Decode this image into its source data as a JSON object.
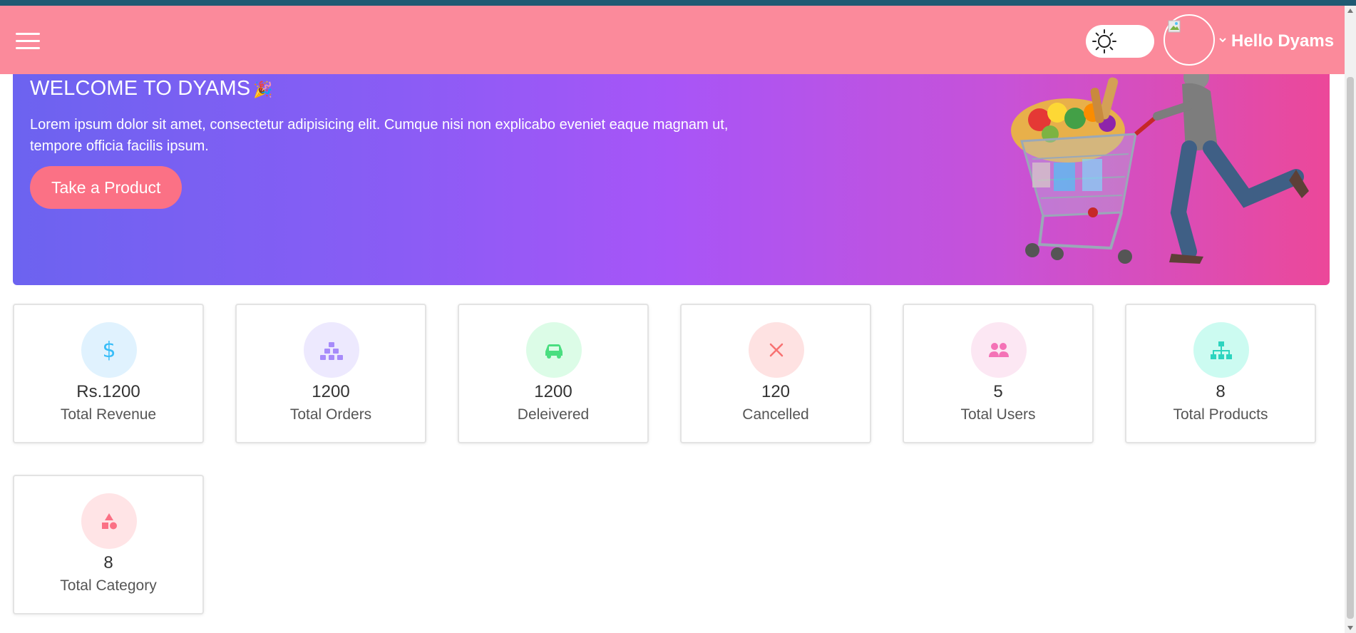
{
  "header": {
    "greeting": "Hello Dyams",
    "menu_icon": "hamburger-icon",
    "theme_icon": "sun-icon",
    "chevron_icon": "chevron-down-icon",
    "bg_color": "#fb8a9b"
  },
  "hero": {
    "title": "WELCOME TO DYAMS",
    "title_icon": "party-popper-icon",
    "text": "Lorem ipsum dolor sit amet, consectetur adipisicing elit. Cumque nisi non explicabo eveniet eaque magnam ut, tempore officia facilis ipsum.",
    "button_label": "Take a Product",
    "button_color": "#fb7185"
  },
  "stats": [
    {
      "value": "Rs.1200",
      "label": "Total Revenue",
      "icon": "dollar-icon",
      "color": "#38bdf8",
      "bg": "#e0f2fe"
    },
    {
      "value": "1200",
      "label": "Total Orders",
      "icon": "boxes-icon",
      "color": "#a78bfa",
      "bg": "#ede9fe"
    },
    {
      "value": "1200",
      "label": "Deleivered",
      "icon": "car-icon",
      "color": "#4ade80",
      "bg": "#dcfce7"
    },
    {
      "value": "120",
      "label": "Cancelled",
      "icon": "close-icon",
      "color": "#f87171",
      "bg": "#fee2e2"
    },
    {
      "value": "5",
      "label": "Total Users",
      "icon": "users-icon",
      "color": "#f472b6",
      "bg": "#fce7f3"
    },
    {
      "value": "8",
      "label": "Total Products",
      "icon": "sitemap-icon",
      "color": "#2dd4bf",
      "bg": "#ccfbf1"
    },
    {
      "value": "8",
      "label": "Total Category",
      "icon": "shapes-icon",
      "color": "#fb7185",
      "bg": "#ffe4e6"
    }
  ]
}
